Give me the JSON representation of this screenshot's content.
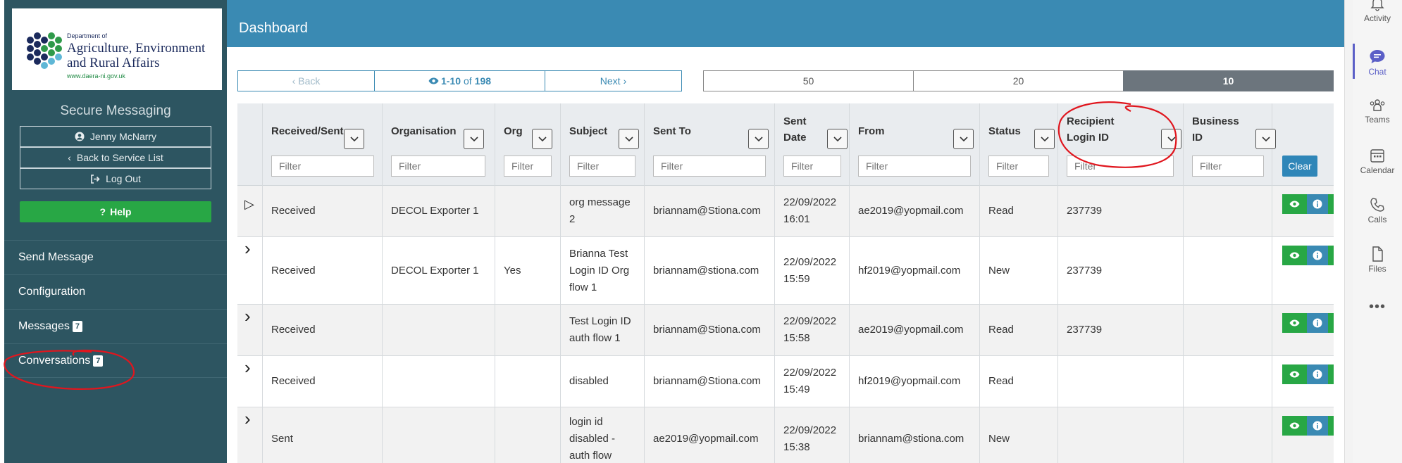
{
  "logo": {
    "dept": "Department of",
    "line1": "Agriculture, Environment",
    "line2": "and Rural Affairs",
    "url": "www.daera-ni.gov.uk"
  },
  "sidebar": {
    "app_title": "Secure Messaging",
    "user_name": "Jenny McNarry",
    "back_label": "Back to Service List",
    "logout_label": "Log Out",
    "help_label": "Help",
    "nav": [
      {
        "label": "Send Message",
        "badge": ""
      },
      {
        "label": "Configuration",
        "badge": ""
      },
      {
        "label": "Messages",
        "badge": "7"
      },
      {
        "label": "Conversations",
        "badge": "7"
      }
    ]
  },
  "header": {
    "title": "Dashboard"
  },
  "pager": {
    "back_label": "Back",
    "range": "1-10",
    "of_label": "of",
    "total": "198",
    "next_label": "Next",
    "page_sizes": [
      "50",
      "20",
      "10"
    ],
    "selected_size": "10"
  },
  "table": {
    "columns": [
      {
        "line1": "Received/Sent",
        "line2": ""
      },
      {
        "line1": "Organisation",
        "line2": ""
      },
      {
        "line1": "Org",
        "line2": ""
      },
      {
        "line1": "Subject",
        "line2": ""
      },
      {
        "line1": "Sent To",
        "line2": ""
      },
      {
        "line1": "Sent",
        "line2": "Date"
      },
      {
        "line1": "From",
        "line2": ""
      },
      {
        "line1": "Status",
        "line2": ""
      },
      {
        "line1": "Recipient",
        "line2": "Login ID"
      },
      {
        "line1": "Business",
        "line2": "ID"
      }
    ],
    "filter_placeholder": "Filter",
    "clear_label": "Clear",
    "rows": [
      {
        "rs": "Received",
        "org": "DECOL Exporter 1",
        "orgflag": "",
        "subject": [
          "org message",
          "2"
        ],
        "sent_to": "briannam@Stiona.com",
        "date": [
          "22/09/2022",
          "16:01"
        ],
        "from": "ae2019@yopmail.com",
        "status": "Read",
        "login": "237739",
        "biz": ""
      },
      {
        "rs": "Received",
        "org": "DECOL Exporter 1",
        "orgflag": "Yes",
        "subject": [
          "Brianna Test",
          "Login ID Org",
          "flow 1"
        ],
        "sent_to": "briannam@stiona.com",
        "date": [
          "22/09/2022",
          "15:59"
        ],
        "from": "hf2019@yopmail.com",
        "status": "New",
        "login": "237739",
        "biz": ""
      },
      {
        "rs": "Received",
        "org": "",
        "orgflag": "",
        "subject": [
          "Test Login ID",
          "auth flow 1"
        ],
        "sent_to": "briannam@Stiona.com",
        "date": [
          "22/09/2022",
          "15:58"
        ],
        "from": "ae2019@yopmail.com",
        "status": "Read",
        "login": "237739",
        "biz": ""
      },
      {
        "rs": "Received",
        "org": "",
        "orgflag": "",
        "subject": [
          "disabled"
        ],
        "sent_to": "briannam@Stiona.com",
        "date": [
          "22/09/2022",
          "15:49"
        ],
        "from": "hf2019@yopmail.com",
        "status": "Read",
        "login": "",
        "biz": ""
      },
      {
        "rs": "Sent",
        "org": "",
        "orgflag": "",
        "subject": [
          "login id",
          "disabled -",
          "auth flow"
        ],
        "sent_to": "ae2019@yopmail.com",
        "date": [
          "22/09/2022",
          "15:38"
        ],
        "from": "briannam@stiona.com",
        "status": "New",
        "login": "",
        "biz": ""
      }
    ]
  },
  "rail": {
    "items": [
      "Activity",
      "Chat",
      "Teams",
      "Calendar",
      "Calls",
      "Files"
    ],
    "active": "Chat"
  },
  "colors": {
    "sidebar": "#2d5561",
    "header": "#3a8ab3",
    "help": "#28a745",
    "annotation": "#e0161e"
  }
}
